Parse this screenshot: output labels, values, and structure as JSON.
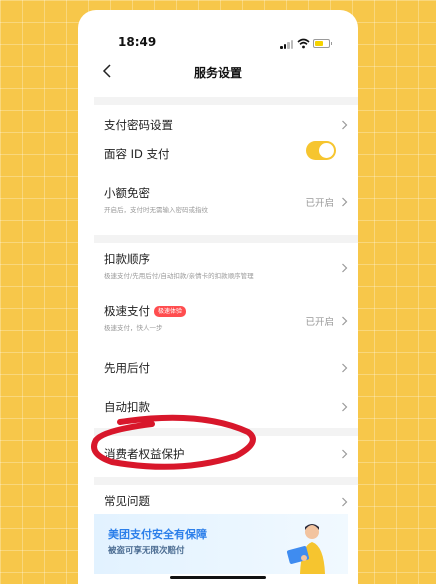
{
  "status_bar": {
    "time": "18:49"
  },
  "nav": {
    "title": "服务设置"
  },
  "rows": {
    "payment_password": {
      "title": "支付密码设置"
    },
    "face_id": {
      "title": "面容 ID 支付",
      "enabled": true
    },
    "small_amount": {
      "title": "小额免密",
      "subtitle": "开启后，支付时无需输入密码或指纹",
      "value": "已开启"
    },
    "deduction_order": {
      "title": "扣款顺序",
      "subtitle": "极速支付/先用后付/自动扣款/亲情卡的扣款顺序管理"
    },
    "express_pay": {
      "title": "极速支付",
      "badge": "极速体验",
      "subtitle": "极速支付，快人一步",
      "value": "已开启"
    },
    "pay_later": {
      "title": "先用后付"
    },
    "auto_deduct": {
      "title": "自动扣款"
    },
    "consumer_rights": {
      "title": "消费者权益保护"
    },
    "faq": {
      "title": "常见问题"
    }
  },
  "banner": {
    "title": "美团支付安全有保障",
    "subtitle": "被盗可享无限次赔付"
  },
  "colors": {
    "accent": "#f6c52f",
    "banner_text": "#2c7fea",
    "badge": "#ff4d4f",
    "annotation": "#d8172b"
  }
}
